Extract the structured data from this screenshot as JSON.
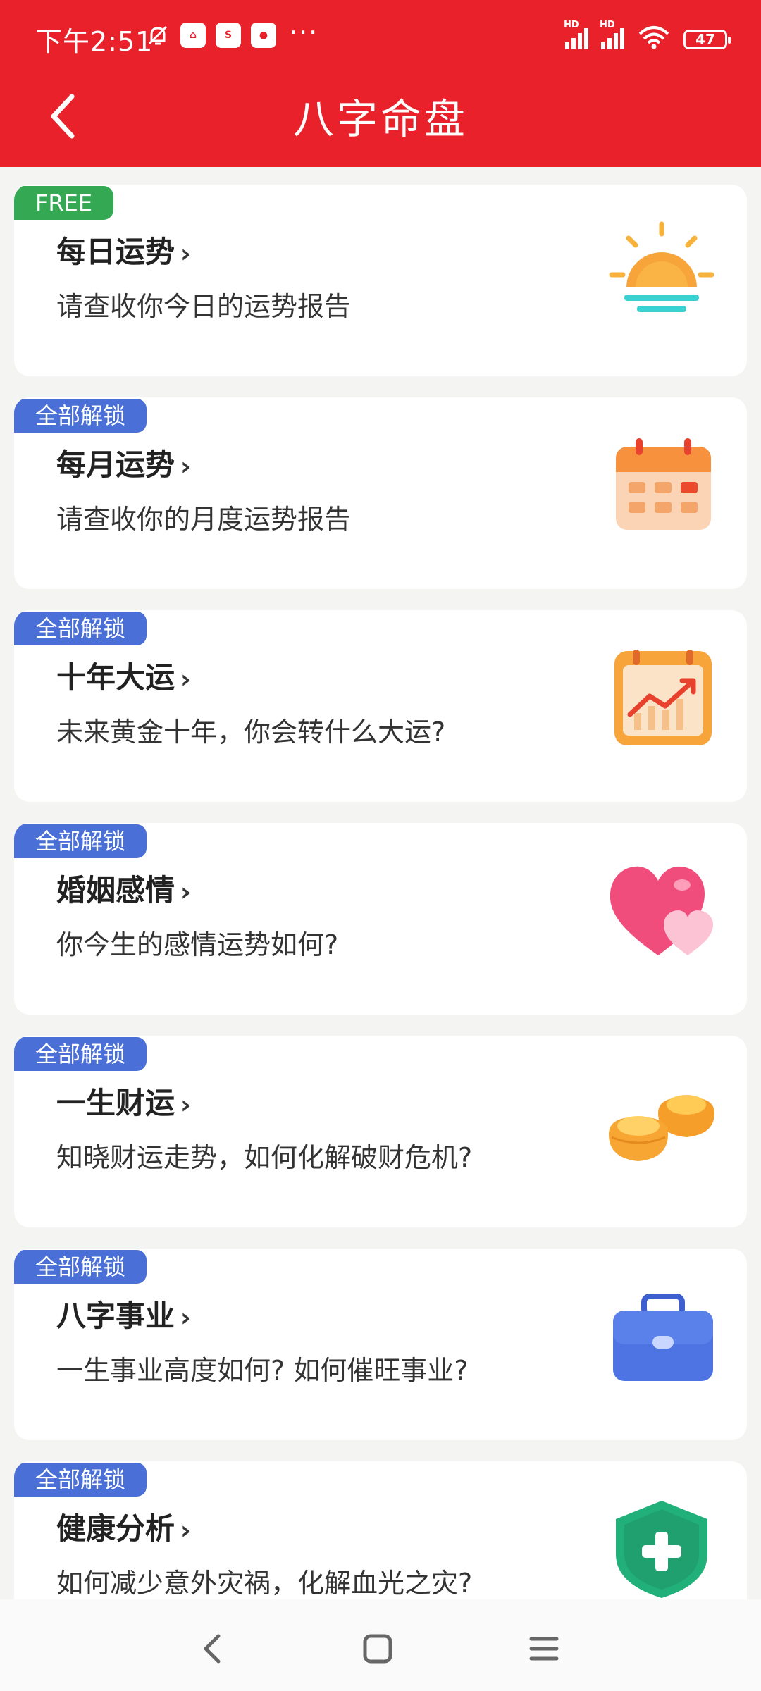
{
  "status_bar": {
    "time": "下午2:51",
    "battery": "47",
    "hd_label": "HD",
    "more": "···"
  },
  "header": {
    "title": "八字命盘"
  },
  "cards": [
    {
      "badge": "FREE",
      "name": "每日运势",
      "chevron": "›",
      "desc": "请查收你今日的运势报告",
      "icon": "sun-icon"
    },
    {
      "badge": "全部解锁",
      "name": "每月运势",
      "chevron": "›",
      "desc": "请查收你的月度运势报告",
      "icon": "calendar-icon"
    },
    {
      "badge": "全部解锁",
      "name": "十年大运",
      "chevron": "›",
      "desc": "未来黄金十年，你会转什么大运?",
      "icon": "trend-chart-icon"
    },
    {
      "badge": "全部解锁",
      "name": "婚姻感情",
      "chevron": "›",
      "desc": "你今生的感情运势如何?",
      "icon": "hearts-icon"
    },
    {
      "badge": "全部解锁",
      "name": "一生财运",
      "chevron": "›",
      "desc": "知晓财运走势，如何化解破财危机?",
      "icon": "gold-ingot-icon"
    },
    {
      "badge": "全部解锁",
      "name": "八字事业",
      "chevron": "›",
      "desc": "一生事业高度如何? 如何催旺事业?",
      "icon": "briefcase-icon"
    },
    {
      "badge": "全部解锁",
      "name": "健康分析",
      "chevron": "›",
      "desc": "如何减少意外灾祸，化解血光之灾?",
      "icon": "health-shield-icon"
    }
  ],
  "colors": {
    "header_bg": "#e8212a",
    "free_badge": "#34a853",
    "lock_badge": "#4a6fd6"
  }
}
